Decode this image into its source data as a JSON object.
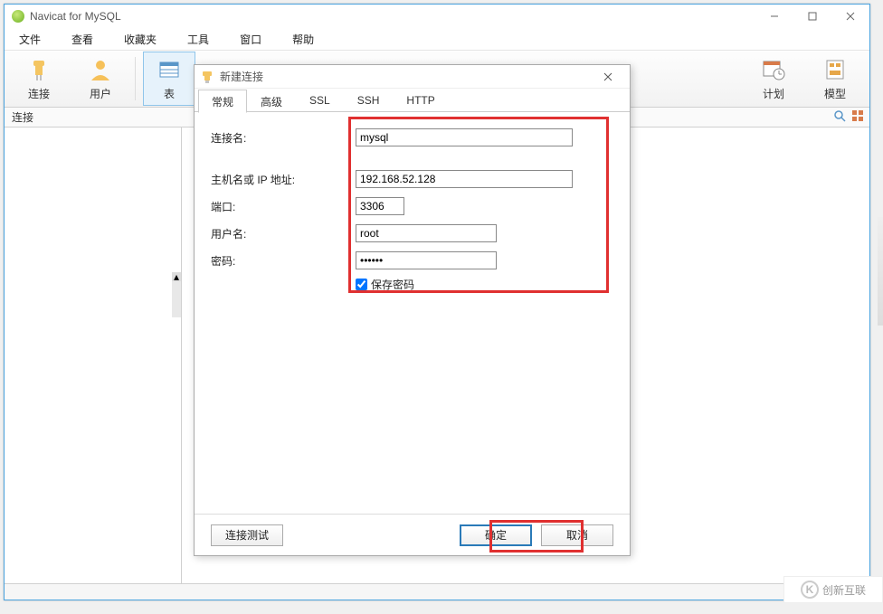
{
  "window": {
    "title": "Navicat for MySQL"
  },
  "menu": {
    "file": "文件",
    "view": "查看",
    "favorites": "收藏夹",
    "tools": "工具",
    "window": "窗口",
    "help": "帮助"
  },
  "toolbar": {
    "connect": "连接",
    "user": "用户",
    "table": "表",
    "plan": "计划",
    "model": "模型"
  },
  "pathbar": {
    "label": "连接"
  },
  "dialog": {
    "title": "新建连接",
    "tabs": {
      "general": "常规",
      "advanced": "高级",
      "ssl": "SSL",
      "ssh": "SSH",
      "http": "HTTP"
    },
    "labels": {
      "conn_name": "连接名:",
      "host": "主机名或 IP 地址:",
      "port": "端口:",
      "user": "用户名:",
      "password": "密码:",
      "save_pw": "保存密码"
    },
    "values": {
      "conn_name": "mysql",
      "host": "192.168.52.128",
      "port": "3306",
      "user": "root",
      "password": "••••••"
    },
    "buttons": {
      "test": "连接测试",
      "ok": "确定",
      "cancel": "取消"
    }
  },
  "watermark": {
    "brand": "创新互联"
  }
}
